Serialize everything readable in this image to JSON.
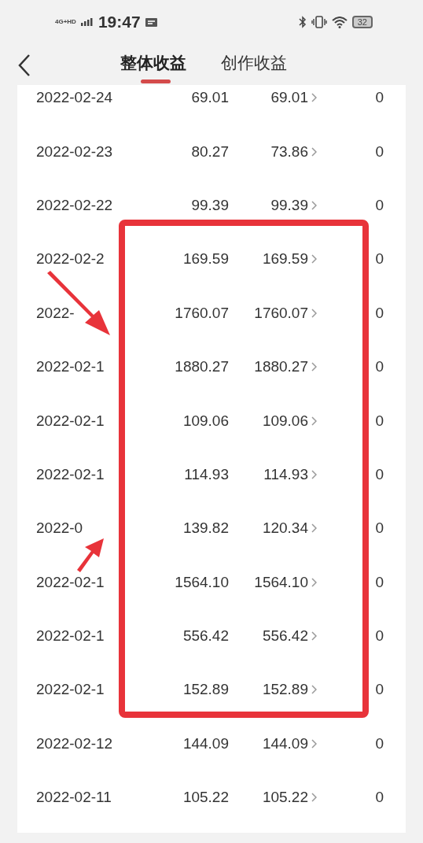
{
  "status_bar": {
    "network": "4G+HD",
    "time": "19:47",
    "battery": "32"
  },
  "tabs": [
    {
      "label": "整体收益",
      "selected": true
    },
    {
      "label": "创作收益",
      "selected": false
    }
  ],
  "rows": [
    {
      "date": "2022-02-24",
      "total": "69.01",
      "creation": "69.01",
      "column_4": "0"
    },
    {
      "date": "2022-02-23",
      "total": "80.27",
      "creation": "73.86",
      "column_4": "0"
    },
    {
      "date": "2022-02-22",
      "total": "99.39",
      "creation": "99.39",
      "column_4": "0"
    },
    {
      "date": "2022-02-2",
      "total": "169.59",
      "creation": "169.59",
      "column_4": "0"
    },
    {
      "date": "2022-",
      "total": "1760.07",
      "creation": "1760.07",
      "column_4": "0"
    },
    {
      "date": "2022-02-1",
      "total": "1880.27",
      "creation": "1880.27",
      "column_4": "0"
    },
    {
      "date": "2022-02-1",
      "total": "109.06",
      "creation": "109.06",
      "column_4": "0"
    },
    {
      "date": "2022-02-1",
      "total": "114.93",
      "creation": "114.93",
      "column_4": "0"
    },
    {
      "date": "2022-0",
      "total": "139.82",
      "creation": "120.34",
      "column_4": "0"
    },
    {
      "date": "2022-02-1",
      "total": "1564.10",
      "creation": "1564.10",
      "column_4": "0"
    },
    {
      "date": "2022-02-1",
      "total": "556.42",
      "creation": "556.42",
      "column_4": "0"
    },
    {
      "date": "2022-02-1",
      "total": "152.89",
      "creation": "152.89",
      "column_4": "0"
    },
    {
      "date": "2022-02-12",
      "total": "144.09",
      "creation": "144.09",
      "column_4": "0"
    },
    {
      "date": "2022-02-11",
      "total": "105.22",
      "creation": "105.22",
      "column_4": "0"
    }
  ]
}
